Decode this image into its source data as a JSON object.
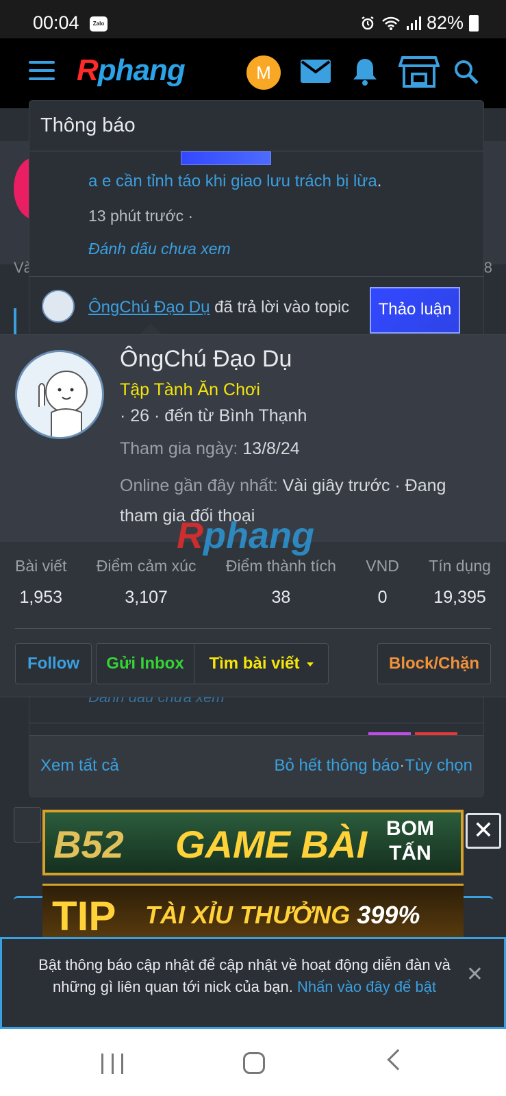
{
  "statusbar": {
    "time": "00:04",
    "zalo_label": "Zalo",
    "battery": "82%"
  },
  "header": {
    "logo_r": "R",
    "logo_rest": "phang",
    "avatar_letter": "M"
  },
  "background": {
    "partial_left": "Và",
    "partial_right": "8"
  },
  "notifications": {
    "title": "Thông báo",
    "item1": {
      "message": "a e cần tỉnh táo khi giao lưu trách bị lừa",
      "message_dot": ".",
      "time": "13 phút trước ·",
      "mark_unread": "Đánh dấu chưa xem"
    },
    "item2": {
      "user": "ÔngChú Đạo Dụ",
      "text": " đã trả lời vào topic ",
      "badge": "Thảo luận"
    },
    "hidden_mark": "Đánh dấu chưa xem",
    "footer": {
      "view_all": "Xem tất cả",
      "dismiss_all": "Bỏ hết thông báo",
      "separator": "·",
      "options": "Tùy chọn"
    }
  },
  "profile": {
    "name": "ÔngChú Đạo Dụ",
    "title": "Tập Tành Ăn Chơi",
    "location": "· 26 · đến từ Bình Thạnh",
    "joined_label": "Tham gia ngày:",
    "joined_value": " 13/8/24",
    "online_label": "Online gần đây nhất:",
    "online_value": " Vài giây trước · Đang tham gia đối thoại",
    "watermark_r": "R",
    "watermark_rest": "phang",
    "stats": [
      {
        "label": "Bài viết",
        "value": "1,953"
      },
      {
        "label": "Điểm cảm xúc",
        "value": "3,107"
      },
      {
        "label": "Điểm thành tích",
        "value": "38"
      },
      {
        "label": "VND",
        "value": "0"
      },
      {
        "label": "Tín dụng",
        "value": "19,395"
      }
    ],
    "buttons": {
      "follow": "Follow",
      "inbox": "Gửi Inbox",
      "find_posts": "Tìm bài viết",
      "block": "Block/Chặn"
    },
    "colors": {
      "title": "#f5e50a",
      "follow": "#3aa0e0",
      "inbox": "#35d435",
      "find": "#f5e50a",
      "block": "#f0923a"
    }
  },
  "ads": {
    "ad1": {
      "brand": "B52",
      "headline": "GAME BÀI",
      "tag_line1": "BOM",
      "tag_line2": "TẤN"
    },
    "ad2": {
      "brand": "TIP",
      "headline": "TÀI XỈU THƯỞNG ",
      "percent": "399%"
    },
    "close_symbol": "✕"
  },
  "push_banner": {
    "text": "Bật thông báo cập nhật để cập nhật về hoạt động diễn đàn và những gì liên quan tới nick của bạn. ",
    "link": "Nhấn vào đây để bật",
    "close_symbol": "✕"
  },
  "theme": {
    "accent": "#3aa0e0",
    "bg": "#1f2227",
    "panel": "#2b2f36"
  }
}
